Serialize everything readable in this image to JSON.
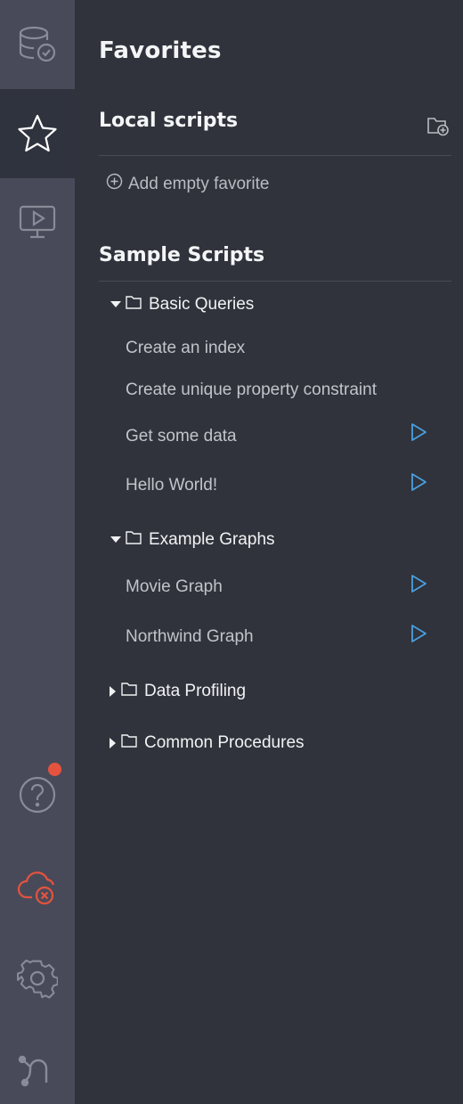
{
  "sidebar": {
    "items": [
      {
        "name": "database-icon"
      },
      {
        "name": "favorites-star-icon",
        "active": true
      },
      {
        "name": "guides-icon"
      },
      {
        "name": "help-icon",
        "has_notification": true
      },
      {
        "name": "cloud-disconnected-icon"
      },
      {
        "name": "settings-icon"
      },
      {
        "name": "about-icon"
      }
    ]
  },
  "colors": {
    "rail_bg": "#494a59",
    "panel_bg": "#30333b",
    "play_blue": "#4a9fe0",
    "notification_red": "#e5533e",
    "cloud_error_red": "#e5533e"
  },
  "favorites": {
    "title": "Favorites",
    "local": {
      "title": "Local scripts",
      "add_empty_label": "Add empty favorite"
    },
    "sample": {
      "title": "Sample Scripts",
      "folders": {
        "basic": {
          "name": "Basic Queries",
          "expanded": true,
          "scripts": [
            "Create an index",
            "Create unique property constraint",
            "Get some data",
            "Hello World!"
          ]
        },
        "example": {
          "name": "Example Graphs",
          "expanded": true,
          "scripts": [
            "Movie Graph",
            "Northwind Graph"
          ]
        },
        "profiling": {
          "name": "Data Profiling",
          "expanded": false
        },
        "procedures": {
          "name": "Common Procedures",
          "expanded": false
        }
      }
    }
  }
}
